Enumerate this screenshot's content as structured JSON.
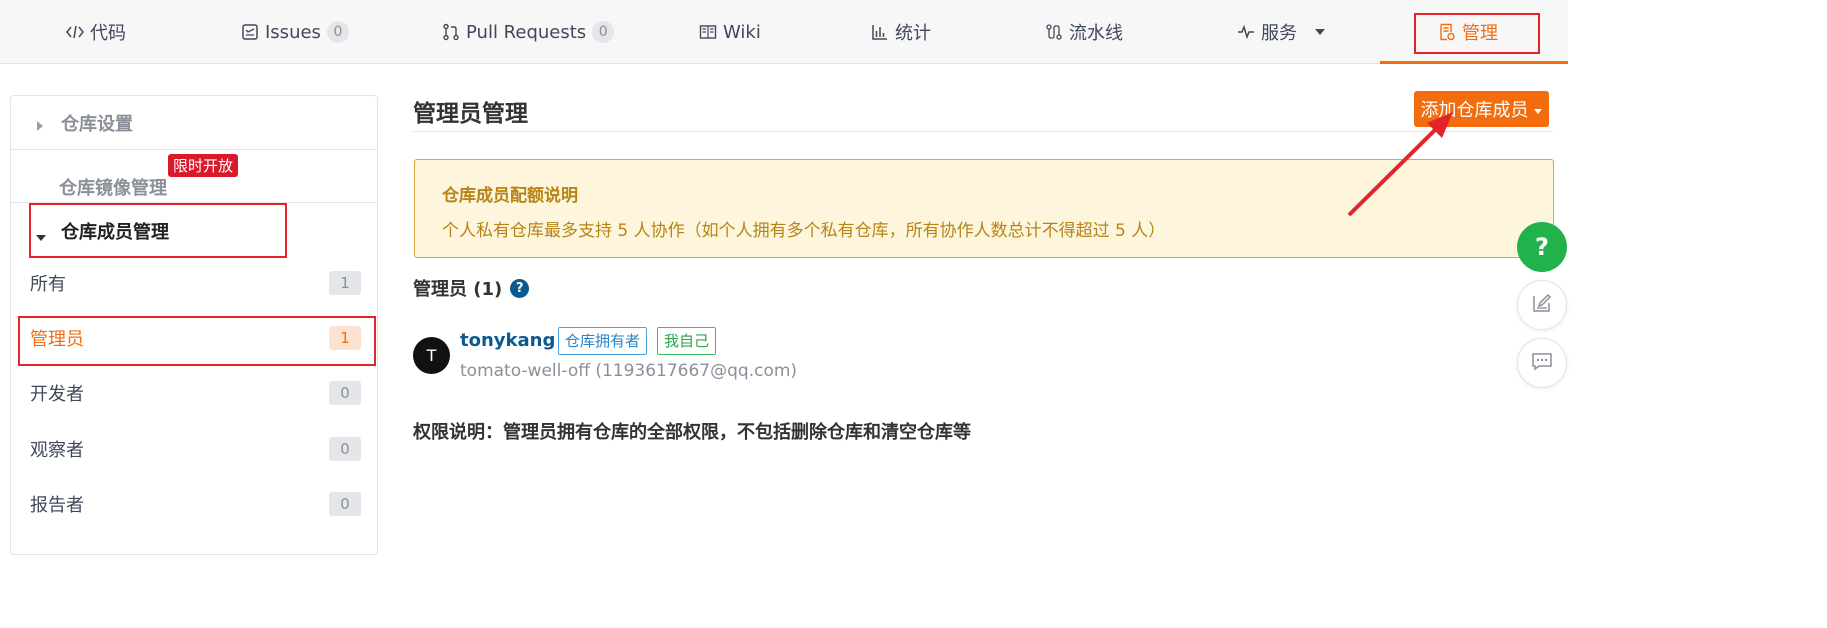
{
  "tabs": [
    {
      "label": "代码",
      "icon": "code-icon"
    },
    {
      "label": "Issues",
      "icon": "issues-icon",
      "count": "0"
    },
    {
      "label": "Pull Requests",
      "icon": "pull-request-icon",
      "count": "0"
    },
    {
      "label": "Wiki",
      "icon": "book-icon"
    },
    {
      "label": "统计",
      "icon": "bar-chart-icon"
    },
    {
      "label": "流水线",
      "icon": "pipeline-icon"
    },
    {
      "label": "服务",
      "icon": "pulse-icon",
      "has_dropdown": true
    },
    {
      "label": "管理",
      "icon": "manage-doc-icon",
      "active": true
    }
  ],
  "sidebar": {
    "repo_settings": "仓库设置",
    "repo_mirror": "仓库镜像管理",
    "limited_badge": "限时开放",
    "members_header": "仓库成员管理",
    "items": [
      {
        "label": "所有",
        "count": "1"
      },
      {
        "label": "管理员",
        "count": "1",
        "active": true
      },
      {
        "label": "开发者",
        "count": "0"
      },
      {
        "label": "观察者",
        "count": "0"
      },
      {
        "label": "报告者",
        "count": "0"
      }
    ]
  },
  "main": {
    "title": "管理员管理",
    "add_member_button": "添加仓库成员",
    "notice": {
      "title": "仓库成员配额说明",
      "text": "个人私有仓库最多支持 5 人协作（如个人拥有多个私有仓库，所有协作人数总计不得超过 5 人）"
    },
    "admins_heading": "管理员 (1)",
    "member": {
      "avatar_letter": "T",
      "username": "tonykang",
      "tags": [
        "仓库拥有者",
        "我自己"
      ],
      "email": "tomato-well-off (1193617667@qq.com)"
    },
    "permission_note": "权限说明：管理员拥有仓库的全部权限，不包括删除仓库和清空仓库等"
  },
  "floating": {
    "help_label": "?"
  },
  "colors": {
    "accent": "#f36d0f",
    "highlight_red": "#e3242b",
    "notice_bg": "#fdf6dd",
    "notice_text": "#b88416",
    "link_blue": "#0b5a8f",
    "help_green": "#22b24c"
  }
}
